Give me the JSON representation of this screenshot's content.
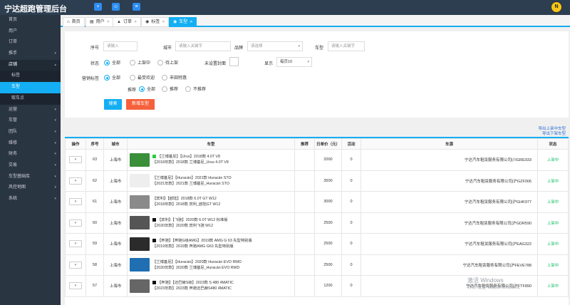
{
  "app_title": "宁达超跑管理后台",
  "topbar": {
    "btn1": "+",
    "btn2": "☺",
    "btn3": "≡",
    "avatar": "N"
  },
  "sidebar": [
    {
      "label": "首页",
      "caret": ""
    },
    {
      "label": "用户",
      "caret": ""
    },
    {
      "label": "订单",
      "caret": ""
    },
    {
      "label": "推手",
      "caret": "▾"
    },
    {
      "label": "店铺",
      "caret": "▴"
    },
    {
      "label": "标签",
      "caret": ""
    },
    {
      "label": "车型",
      "caret": ""
    },
    {
      "label": "取车点",
      "caret": ""
    },
    {
      "label": "运营",
      "caret": "▾"
    },
    {
      "label": "车管",
      "caret": "▾"
    },
    {
      "label": "团队",
      "caret": "▾"
    },
    {
      "label": "维修",
      "caret": "▾"
    },
    {
      "label": "财务",
      "caret": "▾"
    },
    {
      "label": "交易",
      "caret": "▾"
    },
    {
      "label": "车型基础库",
      "caret": "▾"
    },
    {
      "label": "风控地图",
      "caret": "▾"
    },
    {
      "label": "系统",
      "caret": "▾"
    }
  ],
  "tabs": [
    {
      "icon": "⌂",
      "label": "首页",
      "close": ""
    },
    {
      "icon": "▤",
      "label": "用户",
      "close": "✕"
    },
    {
      "icon": "▲",
      "label": "订单",
      "close": "✕"
    },
    {
      "icon": "◉",
      "label": "标签",
      "close": "✕"
    },
    {
      "icon": "◉",
      "label": "车型",
      "close": "✕"
    }
  ],
  "filters": {
    "id_label": "序号",
    "id_placeholder": "请输入",
    "city_label": "城市",
    "city_placeholder": "请输入关键字",
    "brand_label": "品牌",
    "brand_placeholder": "请选择",
    "model_label": "车型",
    "model_placeholder": "请输入关键字",
    "status_label": "状态",
    "status_options": [
      "全部",
      "上架中",
      "待上架"
    ],
    "cover_label": "未设置封面",
    "show_label": "显示",
    "show_value": "每页10",
    "tag_label": "营销标签",
    "tag_options": [
      "全部",
      "最受欢迎",
      "丰田特惠"
    ],
    "rec_label": "推荐",
    "rec_options": [
      "全部",
      "推荐",
      "不推荐"
    ],
    "search_btn": "搜索",
    "add_btn": "新增车型"
  },
  "exports": {
    "up": "导出上架中车型",
    "down": "导出下架车型"
  },
  "table": {
    "headers": [
      "操作",
      "序号",
      "城市",
      "车型",
      "推荐",
      "日单价（元）",
      "活动",
      "车源",
      "状态"
    ],
    "op_label": "▾",
    "rows": [
      {
        "id": "63",
        "city": "上海市",
        "line1": "【兰博基尼】【Urus】2018款 4.0T V8",
        "line2": "【2018年款】2018款 兰博基尼_Urus 4.0T V8",
        "price": "2000",
        "activity": "0",
        "source": "宁达汽车租赁服务有限公司|川GRE933",
        "status": "上架中",
        "tag": "#2ecc40",
        "thumb": "#3a8f3a"
      },
      {
        "id": "62",
        "city": "上海市",
        "line1": "【兰博基尼】【Huracán】2021款 Huracán STO",
        "line2": "【2021年款】2021款 兰博基尼_Huracán STO",
        "price": "3500",
        "activity": "0",
        "source": "宁达汽车租赁服务有限公司|沪GZF006",
        "status": "上架中",
        "tag": "",
        "thumb": "#eeeeee"
      },
      {
        "id": "61",
        "city": "上海市",
        "line1": "【宾利】【欧陆】2018款 6.0T GT W12",
        "line2": "【2018年款】2018款 宾利_欧陆GT W12",
        "price": "3000",
        "activity": "0",
        "source": "宁达汽车租赁服务有限公司|沪GHK977",
        "status": "上架中",
        "tag": "",
        "thumb": "#8a8a8a"
      },
      {
        "id": "60",
        "city": "上海市",
        "line1": "【宾利】【飞驰】2020款 6.0T W12 标准版",
        "line2": "【2020年款】2020款 宾利飞驰 W12",
        "price": "2500",
        "activity": "0",
        "source": "宁达汽车租赁服务有限公司|沪GDR590",
        "status": "上架中",
        "tag": "#111111",
        "thumb": "#555555"
      },
      {
        "id": "59",
        "city": "上海市",
        "line1": "【奔驰】【奔驰G级AMG】2019款 AMG G 63 先型特别版",
        "line2": "【2019年款】2019款 奔驰AMG G63 先型特别版",
        "price": "2500",
        "activity": "0",
        "source": "宁达汽车租赁服务有限公司|沪EAG322",
        "status": "上架中",
        "tag": "#111111",
        "thumb": "#2b2b2b"
      },
      {
        "id": "58",
        "city": "上海市",
        "line1": "【兰博基尼】【Huracán】2020款 Huracán EVO RWD",
        "line2": "【2020年款】2020款 兰博基尼_Huracán EVO RWD",
        "price": "2500",
        "activity": "0",
        "source": "宁达汽车租赁服务有限公司|沪FEVE788",
        "status": "上架中",
        "tag": "",
        "thumb": "#1f6fb2"
      },
      {
        "id": "57",
        "city": "上海市",
        "line1": "【奔驰】【迈巴赫S级】2023款 S 480 4MATIC",
        "line2": "【2023年款】2023款 奔驰迈巴赫S480 4MATIC",
        "price": "1200",
        "activity": "0",
        "source": "宁达汽车租赁服务有限公司|沪FTF890",
        "status": "上架中",
        "tag": "#111111",
        "thumb": "#666666"
      }
    ]
  },
  "watermark": {
    "line1": "激活 Windows",
    "line2": "转到“设置”以激活 Windows。"
  }
}
